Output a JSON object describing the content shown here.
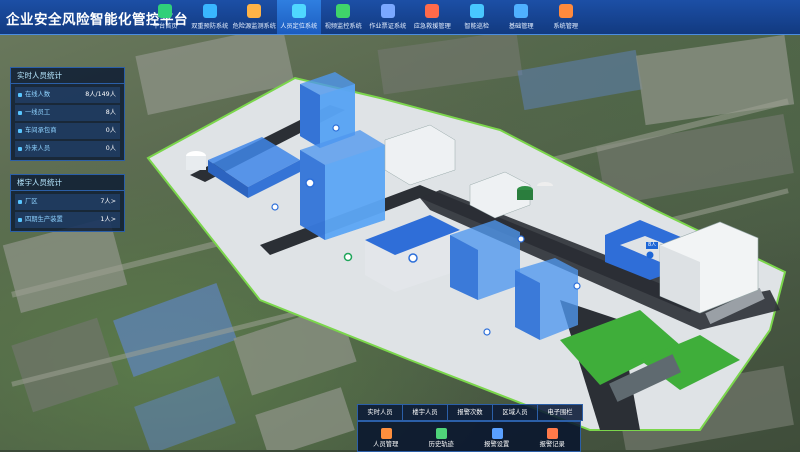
{
  "app": {
    "title": "企业安全风险智能化管控平台"
  },
  "nav": [
    {
      "label": "平台首页",
      "icon": "home-icon",
      "color": "#2fd07a"
    },
    {
      "label": "双重预防系统",
      "icon": "shield-icon",
      "color": "#39b7ff"
    },
    {
      "label": "危险源监测系统",
      "icon": "warning-monitor-icon",
      "color": "#ffb347"
    },
    {
      "label": "人员定位系统",
      "icon": "location-icon",
      "color": "#4fd8ff",
      "active": true
    },
    {
      "label": "视频监控系统",
      "icon": "camera-icon",
      "color": "#3fd46a"
    },
    {
      "label": "作业票证系统",
      "icon": "ticket-icon",
      "color": "#7aa8ff"
    },
    {
      "label": "应急救援管理",
      "icon": "alert-icon",
      "color": "#ff6a4a"
    },
    {
      "label": "智能巡检",
      "icon": "inspect-icon",
      "color": "#48c7ff"
    },
    {
      "label": "基础管理",
      "icon": "grid-icon",
      "color": "#4fb0ff"
    },
    {
      "label": "系统管理",
      "icon": "gear-icon",
      "color": "#ff8a3d"
    }
  ],
  "realtime_stats": {
    "title": "实时人员统计",
    "rows": [
      {
        "label": "在线人数",
        "value": "8人/149人"
      },
      {
        "label": "一线员工",
        "value": "8人"
      },
      {
        "label": "车间承包商",
        "value": "0人"
      },
      {
        "label": "外来人员",
        "value": "0人"
      }
    ]
  },
  "building_stats": {
    "title": "楼宇人员统计",
    "rows": [
      {
        "label": "厂区",
        "value": "7人>"
      },
      {
        "label": "四期生产装置",
        "value": "1人>"
      }
    ]
  },
  "bottom_tabs": [
    "实时人员",
    "楼宇人员",
    "报警次数",
    "区域人员",
    "电子围栏"
  ],
  "bottom_actions": [
    {
      "label": "人员管理",
      "icon": "user-manage-icon",
      "color": "#ff8f3d"
    },
    {
      "label": "历史轨迹",
      "icon": "history-icon",
      "color": "#4fd47a"
    },
    {
      "label": "报警设置",
      "icon": "alarm-settings-icon",
      "color": "#5aa0ff"
    },
    {
      "label": "报警记录",
      "icon": "alarm-record-icon",
      "color": "#ff7a4a"
    }
  ],
  "map_tags": [
    "",
    "8人"
  ]
}
